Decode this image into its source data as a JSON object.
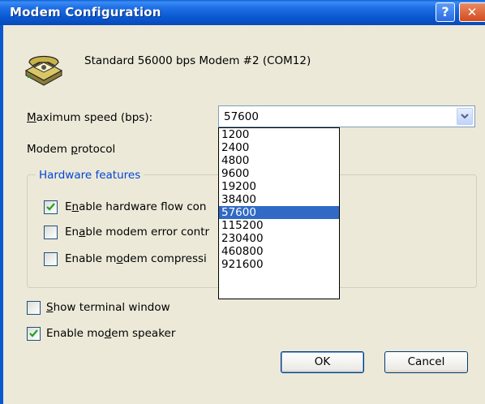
{
  "window": {
    "title": "Modem Configuration",
    "help_glyph": "?",
    "close_glyph": "✕"
  },
  "modem": {
    "name": "Standard 56000 bps Modem #2 (COM12)"
  },
  "speed": {
    "label_accel": "M",
    "label_rest": "aximum speed (bps):",
    "selected": "57600",
    "options": [
      "1200",
      "2400",
      "4800",
      "9600",
      "19200",
      "38400",
      "57600",
      "115200",
      "230400",
      "460800",
      "921600"
    ]
  },
  "protocol": {
    "label_pre": "Modem ",
    "label_accel": "p",
    "label_rest": "rotocol"
  },
  "hardware": {
    "group_title": "Hardware features",
    "flow_control": {
      "checked": true,
      "pre": "E",
      "accel": "n",
      "rest": "able hardware flow con"
    },
    "error_control": {
      "checked": false,
      "pre": "En",
      "accel": "a",
      "rest": "ble modem error contr"
    },
    "compression": {
      "checked": false,
      "pre": "Enable m",
      "accel": "o",
      "rest": "dem compressi"
    }
  },
  "options": {
    "terminal": {
      "checked": false,
      "accel": "S",
      "rest": "how terminal window"
    },
    "speaker": {
      "checked": true,
      "pre": "Enable mo",
      "accel": "d",
      "rest": "em speaker"
    }
  },
  "buttons": {
    "ok": "OK",
    "cancel": "Cancel"
  },
  "colors": {
    "titlebar": "#0a58d0",
    "dialog_bg": "#ece9d8",
    "selection": "#316ac5",
    "group_title": "#0046d5",
    "check_mark": "#21a121"
  }
}
